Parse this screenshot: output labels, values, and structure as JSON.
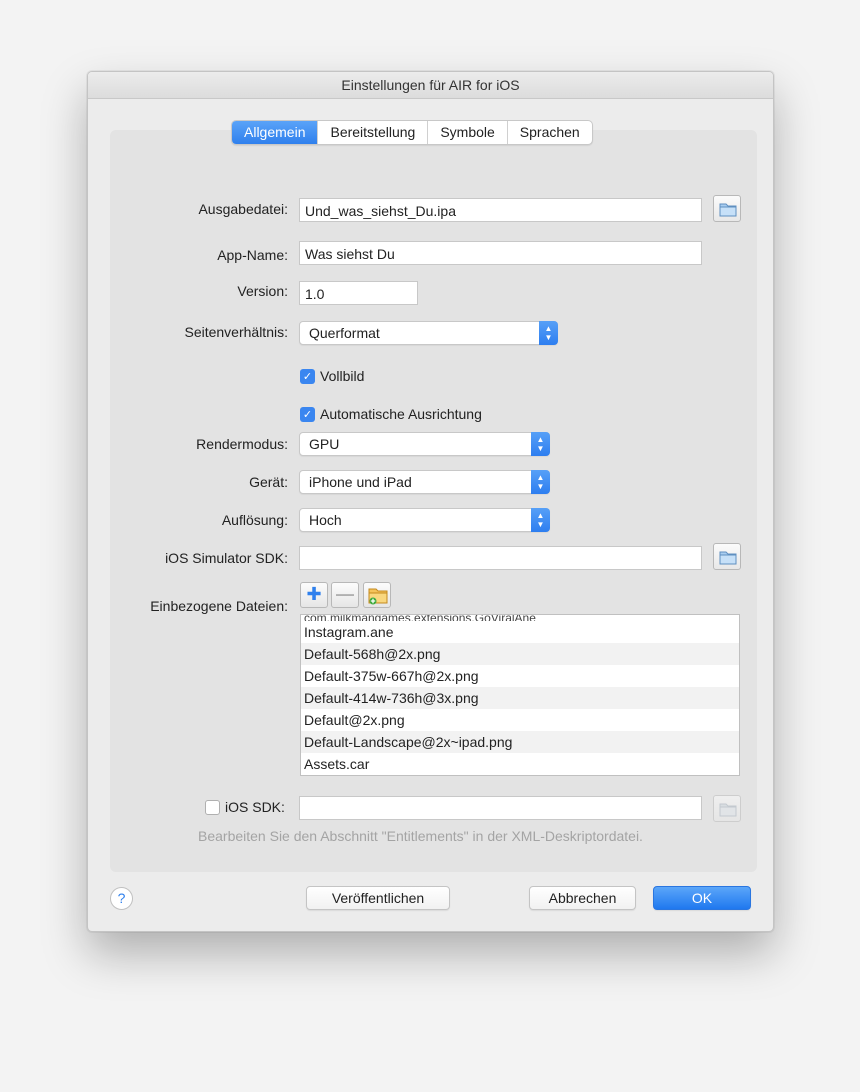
{
  "window": {
    "title": "Einstellungen für AIR for iOS"
  },
  "tabs": [
    "Allgemein",
    "Bereitstellung",
    "Symbole",
    "Sprachen"
  ],
  "form": {
    "ausgabedatei": {
      "label": "Ausgabedatei:",
      "value": "Und_was_siehst_Du.ipa"
    },
    "app_name": {
      "label": "App-Name:",
      "value": "Was siehst Du"
    },
    "version": {
      "label": "Version:",
      "value": "1.0"
    },
    "seitenverhaeltnis": {
      "label": "Seitenverhältnis:",
      "value": "Querformat"
    },
    "vollbild": {
      "label": "Vollbild",
      "checked": true
    },
    "auto_ausrichtung": {
      "label": "Automatische Ausrichtung",
      "checked": true
    },
    "rendermodus": {
      "label": "Rendermodus:",
      "value": "GPU"
    },
    "geraet": {
      "label": "Gerät:",
      "value": "iPhone und iPad"
    },
    "aufloesung": {
      "label": "Auflösung:",
      "value": "Hoch"
    },
    "ios_simulator_sdk": {
      "label": "iOS Simulator SDK:",
      "value": ""
    },
    "einbezogene_dateien": {
      "label": "Einbezogene Dateien:"
    },
    "ios_sdk": {
      "label": "iOS SDK:",
      "checked": false,
      "value": ""
    }
  },
  "files": [
    "Instagram.ane",
    "Default-568h@2x.png",
    "Default-375w-667h@2x.png",
    "Default-414w-736h@3x.png",
    "Default@2x.png",
    "Default-Landscape@2x~ipad.png",
    "Assets.car"
  ],
  "files_partial_top": "com.milkmangames.extensions.GoViralAne",
  "hint": "Bearbeiten Sie den Abschnitt \"Entitlements\" in der XML-Deskriptordatei.",
  "buttons": {
    "help": "?",
    "publish": "Veröffentlichen",
    "cancel": "Abbrechen",
    "ok": "OK"
  },
  "colors": {
    "accent": "#2f80ed",
    "panel": "#e3e3e3",
    "window": "#ececec"
  },
  "icons": [
    "folder-icon",
    "add-icon",
    "remove-icon",
    "add-folder-icon",
    "stepper-arrows-icon",
    "checkmark-icon",
    "help-icon"
  ]
}
